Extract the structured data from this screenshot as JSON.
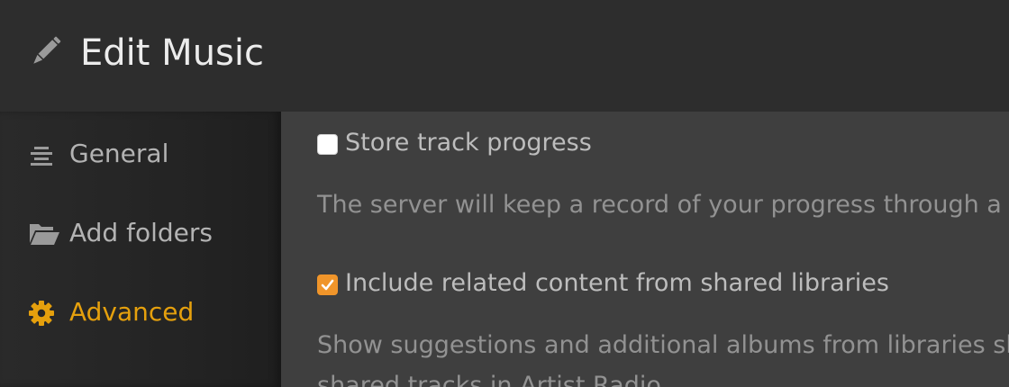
{
  "header": {
    "title": "Edit Music",
    "icon": "pencil-icon"
  },
  "sidebar": {
    "items": [
      {
        "label": "General",
        "icon": "align-center-icon",
        "active": false
      },
      {
        "label": "Add folders",
        "icon": "folder-open-icon",
        "active": false
      },
      {
        "label": "Advanced",
        "icon": "gear-icon",
        "active": true
      }
    ]
  },
  "main": {
    "options": [
      {
        "label": "Store track progress",
        "checked": false,
        "description": "The server will keep a record of your progress through a tra"
      },
      {
        "label": "Include related content from shared libraries",
        "checked": true,
        "description": "Show suggestions and additional albums from libraries sha include shared tracks in Artist Radio."
      }
    ]
  },
  "colors": {
    "header_bg": "#2d2d2d",
    "content_bg": "#3f3f3f",
    "accent": "#e5a00d",
    "checkbox_checked": "#f0952a"
  }
}
